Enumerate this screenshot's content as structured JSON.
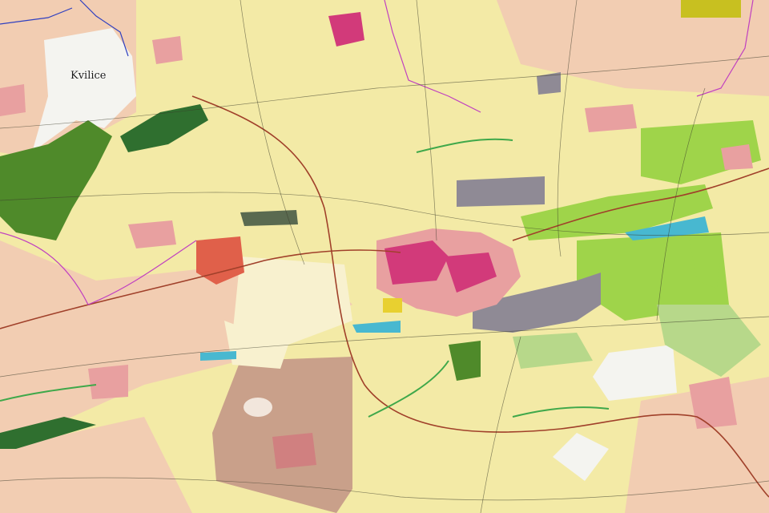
{
  "map": {
    "place_labels": {
      "kvilice": "Kvilice"
    },
    "colors": {
      "farmland": "#f3eaa6",
      "pasture": "#e8f08a",
      "grassland_bright": "#9fd44a",
      "meadow": "#b7d88a",
      "forest": "#4f8a2a",
      "forest_dark": "#2f6f2f",
      "urban_core": "#d23a7a",
      "urban_residential": "#e8a0a0",
      "urban_red": "#e0604a",
      "industrial": "#8f8a95",
      "water": "#48b8d0",
      "quarry_brown": "#c9a08a",
      "white_area": "#f4f4f0",
      "railway": "#a0402a",
      "boundary_purple": "#c040c0",
      "boundary_blue": "#3040c0",
      "roads_dark": "#3a3a2a"
    }
  }
}
